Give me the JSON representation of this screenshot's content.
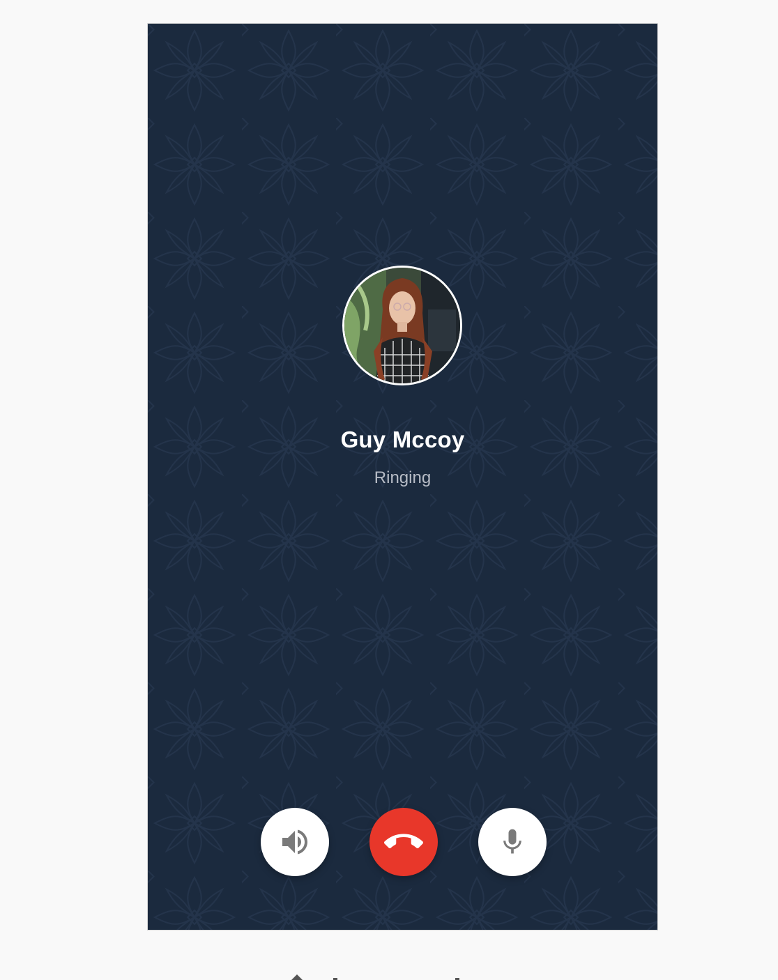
{
  "caller": {
    "name": "Guy Mccoy",
    "status": "Ringing",
    "avatar_icon": "caller-photo"
  },
  "controls": {
    "speaker_icon": "speaker-icon",
    "end_call_icon": "end-call-icon",
    "mute_icon": "microphone-icon"
  },
  "colors": {
    "background": "#1b2a3e",
    "end_call": "#e8372a",
    "control_button": "#ffffff",
    "status_text": "#b7bcc6"
  }
}
